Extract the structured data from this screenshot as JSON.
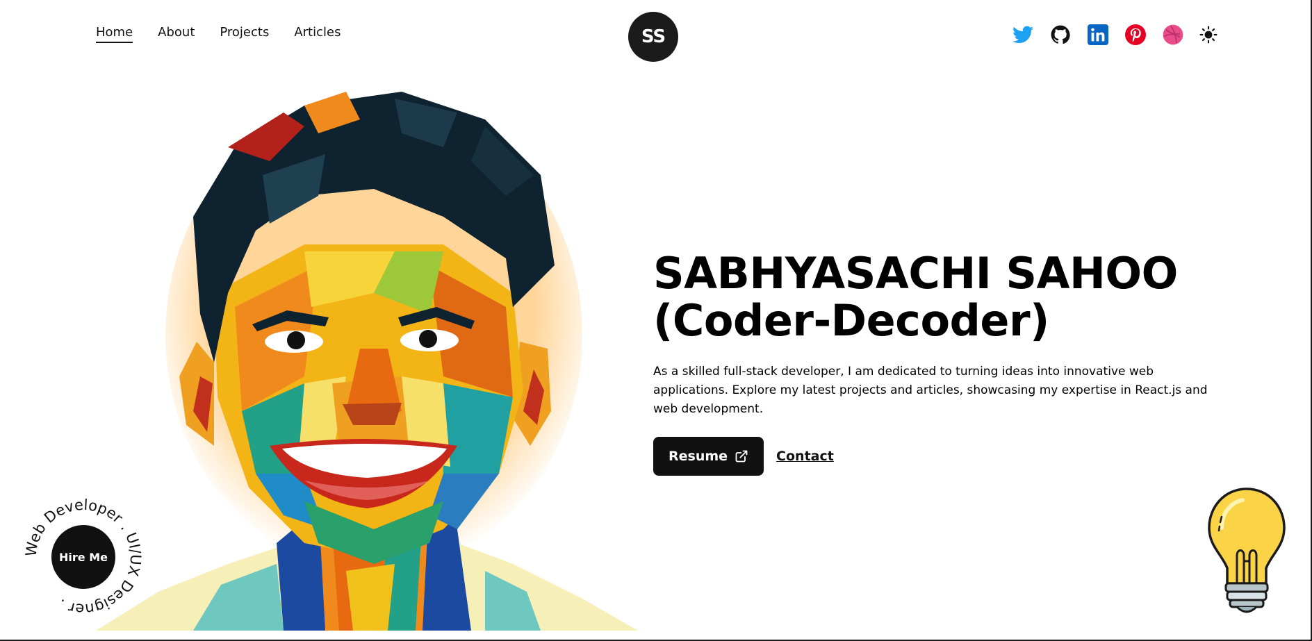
{
  "nav": {
    "items": [
      {
        "label": "Home",
        "active": true
      },
      {
        "label": "About",
        "active": false
      },
      {
        "label": "Projects",
        "active": false
      },
      {
        "label": "Articles",
        "active": false
      }
    ]
  },
  "logo": {
    "initials": "SS"
  },
  "socials": [
    "twitter-icon",
    "github-icon",
    "linkedin-icon",
    "pinterest-icon",
    "dribbble-icon",
    "sun-icon"
  ],
  "hero": {
    "name": "SABHYASACHI SAHOO",
    "alias": "(Coder-Decoder)",
    "description": "As a skilled full-stack developer, I am dedicated to turning ideas into innovative web applications. Explore my latest projects and articles, showcasing my expertise in React.js and web development.",
    "resume_label": "Resume",
    "contact_label": "Contact"
  },
  "hire": {
    "label": "Hire Me",
    "ring_text": "Web Developer . UI/UX Designer . "
  },
  "colors": {
    "primary": "#1b1b1b",
    "background": "#ffffff",
    "twitter": "#1da1f2",
    "linkedin": "#0a66c2",
    "pinterest": "#e60023",
    "dribbble": "#ea4c89",
    "bulb": "#fbd347"
  }
}
